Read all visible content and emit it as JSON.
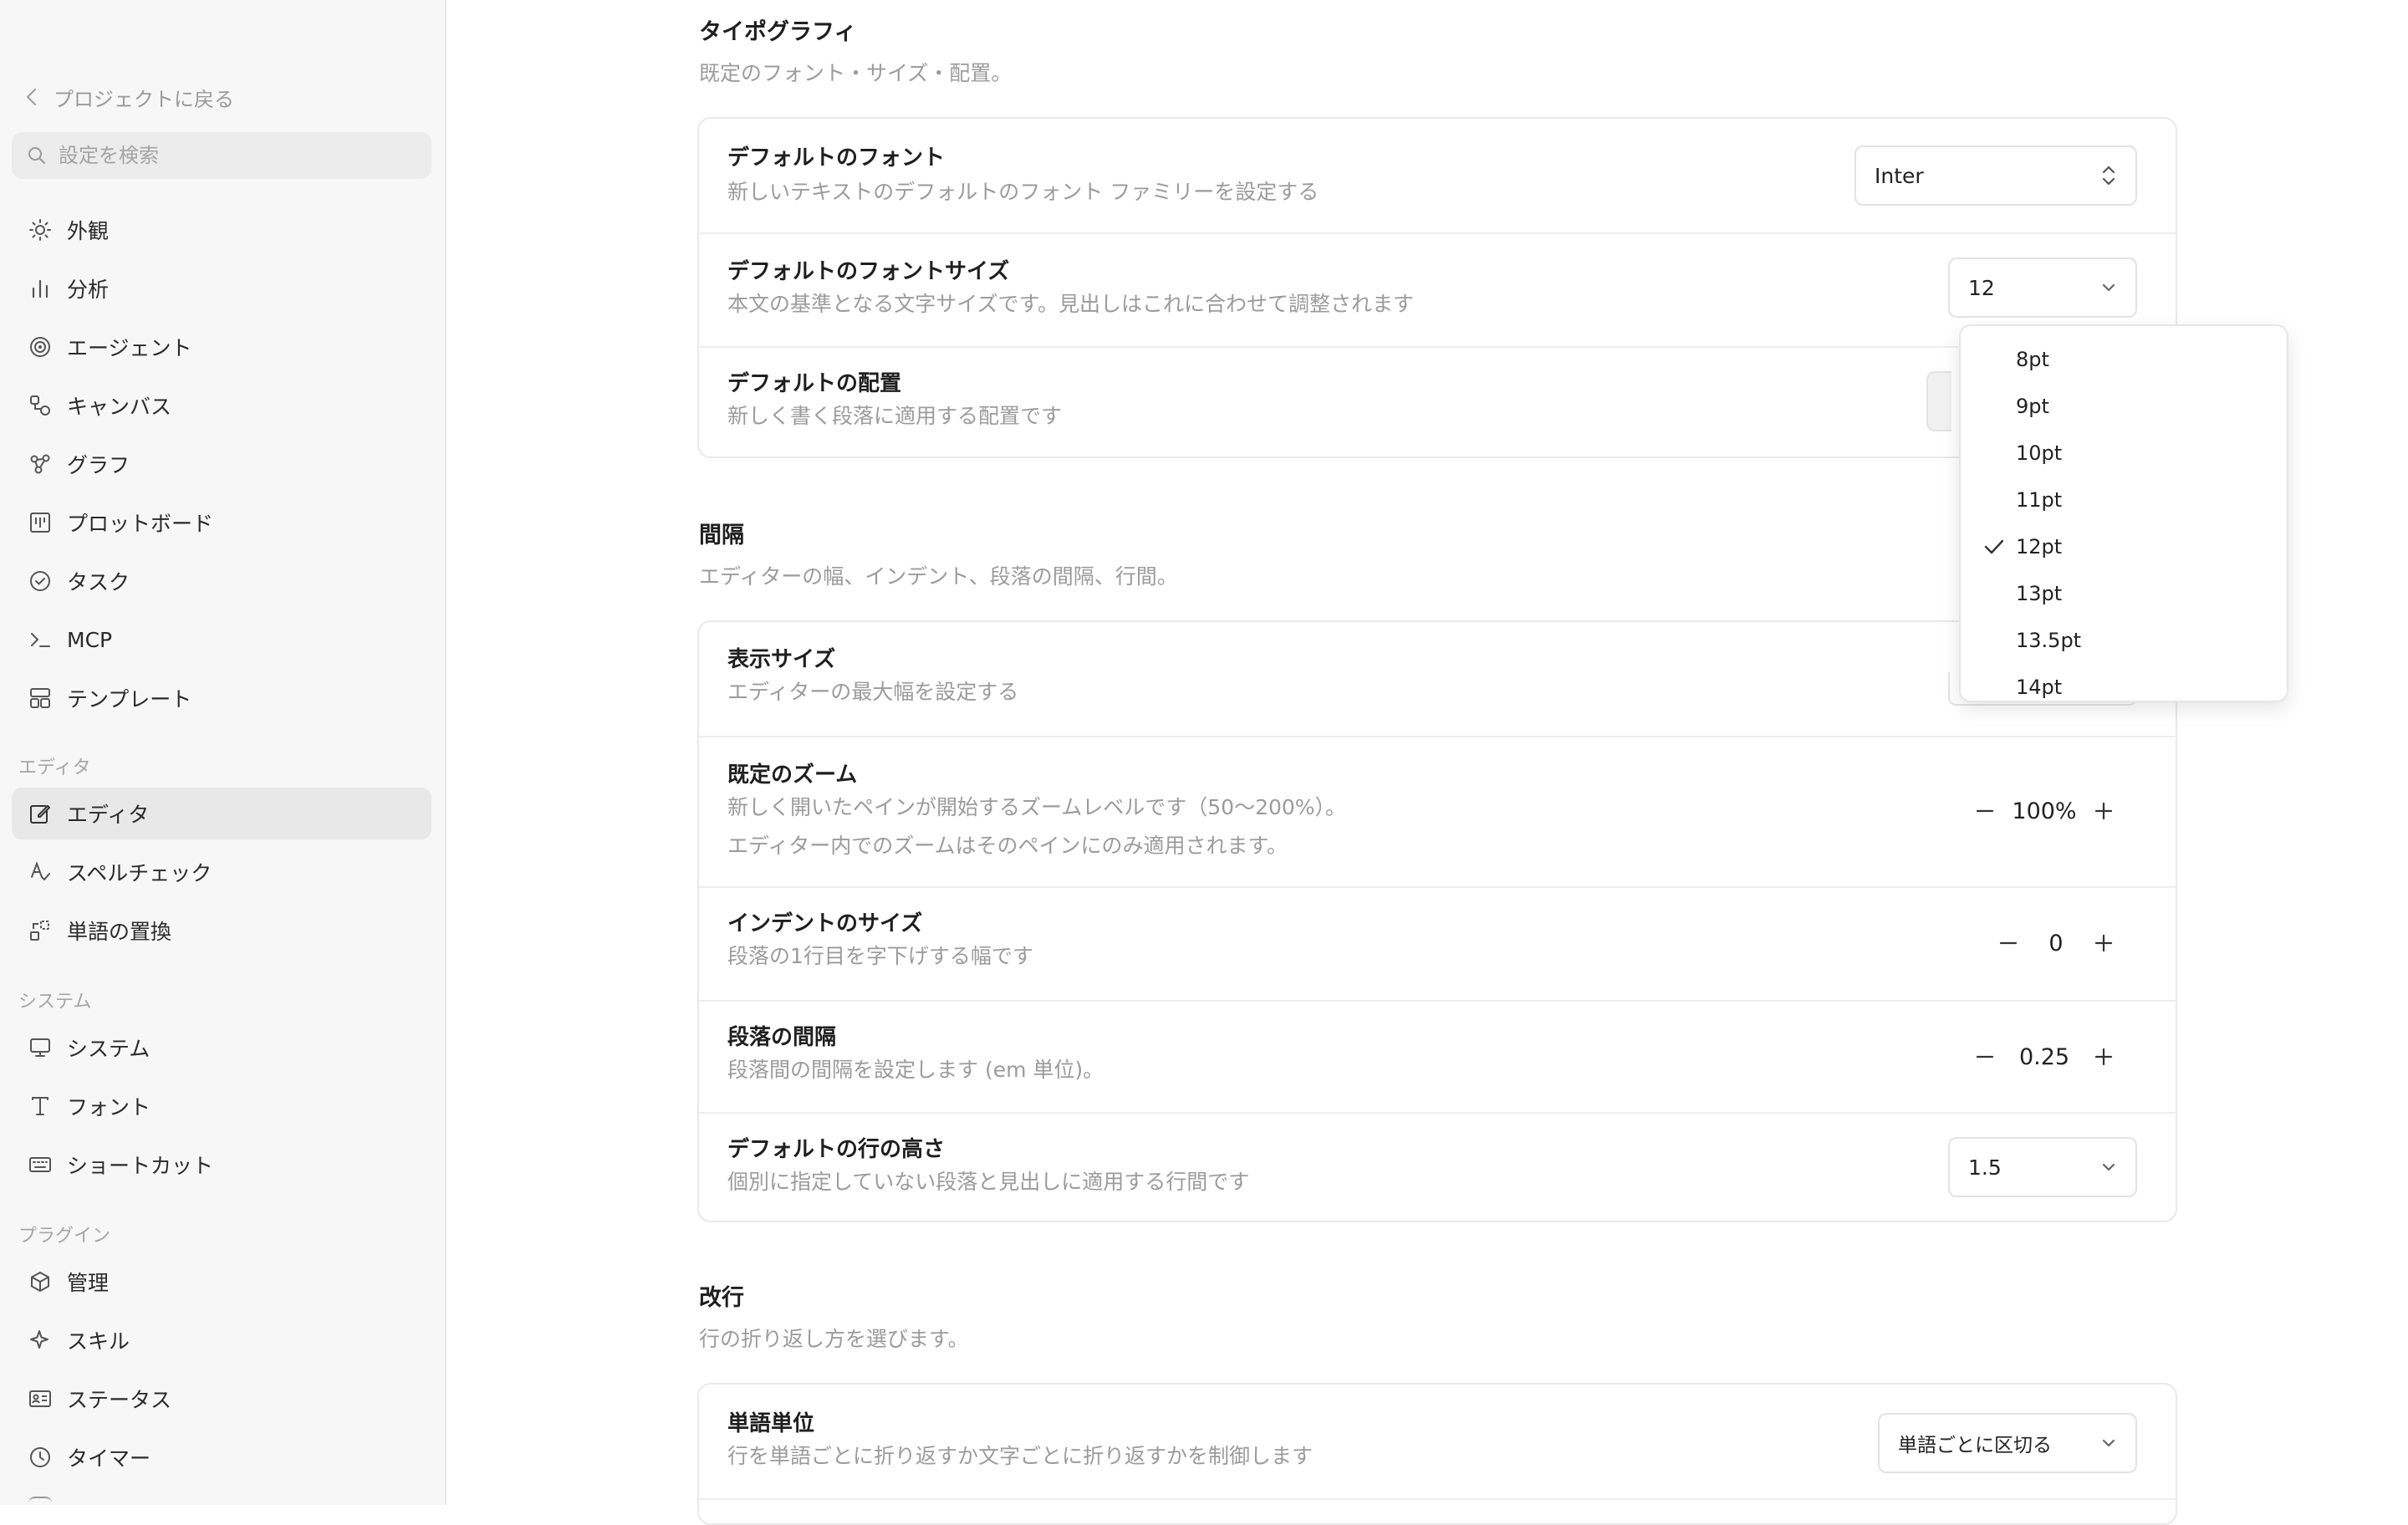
{
  "sidebar": {
    "back_label": "プロジェクトに戻る",
    "search_placeholder": "設定を検索",
    "items_top": [
      {
        "label": "外観",
        "icon": "sun-icon"
      },
      {
        "label": "分析",
        "icon": "bar-chart-icon"
      },
      {
        "label": "エージェント",
        "icon": "spiral-icon"
      },
      {
        "label": "キャンバス",
        "icon": "canvas-icon"
      },
      {
        "label": "グラフ",
        "icon": "graph-icon"
      },
      {
        "label": "プロットボード",
        "icon": "board-icon"
      },
      {
        "label": "タスク",
        "icon": "check-circle-icon"
      },
      {
        "label": "MCP",
        "icon": "terminal-icon"
      },
      {
        "label": "テンプレート",
        "icon": "template-icon"
      }
    ],
    "editor_section": "エディタ",
    "items_editor": [
      {
        "label": "エディタ",
        "icon": "edit-icon",
        "active": true
      },
      {
        "label": "スペルチェック",
        "icon": "spellcheck-icon"
      },
      {
        "label": "単語の置換",
        "icon": "replace-icon"
      }
    ],
    "system_section": "システム",
    "items_system": [
      {
        "label": "システム",
        "icon": "monitor-icon"
      },
      {
        "label": "フォント",
        "icon": "type-icon"
      },
      {
        "label": "ショートカット",
        "icon": "keyboard-icon"
      }
    ],
    "plugin_section": "プラグイン",
    "items_plugin": [
      {
        "label": "管理",
        "icon": "cube-icon"
      },
      {
        "label": "スキル",
        "icon": "sparkle-icon"
      },
      {
        "label": "ステータス",
        "icon": "id-card-icon"
      },
      {
        "label": "タイマー",
        "icon": "clock-icon"
      }
    ]
  },
  "typography": {
    "title": "タイポグラフィ",
    "desc": "既定のフォント・サイズ・配置。",
    "font": {
      "title": "デフォルトのフォント",
      "desc": "新しいテキストのデフォルトのフォント ファミリーを設定する",
      "value": "Inter"
    },
    "font_size": {
      "title": "デフォルトのフォントサイズ",
      "desc": "本文の基準となる文字サイズです。見出しはこれに合わせて調整されます",
      "value": "12"
    },
    "alignment": {
      "title": "デフォルトの配置",
      "desc": "新しく書く段落に適用する配置です"
    }
  },
  "spacing": {
    "title": "間隔",
    "desc": "エディターの幅、インデント、段落の間隔、行間。",
    "display_size": {
      "title": "表示サイズ",
      "desc": "エディターの最大幅を設定する"
    },
    "zoom": {
      "title": "既定のズーム",
      "desc1": "新しく開いたペインが開始するズームレベルです（50〜200%）。",
      "desc2": "エディター内でのズームはそのペインにのみ適用されます。",
      "value": "100%"
    },
    "indent": {
      "title": "インデントのサイズ",
      "desc": "段落の1行目を字下げする幅です",
      "value": "0"
    },
    "paragraph": {
      "title": "段落の間隔",
      "desc": "段落間の間隔を設定します (em 単位)。",
      "value": "0.25"
    },
    "line_height": {
      "title": "デフォルトの行の高さ",
      "desc": "個別に指定していない段落と見出しに適用する行間です",
      "value": "1.5"
    }
  },
  "line_break": {
    "title": "改行",
    "desc": "行の折り返し方を選びます。",
    "word_unit": {
      "title": "単語単位",
      "desc": "行を単語ごとに折り返すか文字ごとに折り返すかを制御します",
      "value": "単語ごとに区切る"
    }
  },
  "dropdown": {
    "options": [
      "8pt",
      "9pt",
      "10pt",
      "11pt",
      "12pt",
      "13pt",
      "13.5pt",
      "14pt"
    ],
    "selected": "12pt"
  },
  "colors": {
    "active_bg": "#e8e8e8",
    "sidebar_bg": "#f7f7f7",
    "muted_text": "#9b9b9b"
  }
}
